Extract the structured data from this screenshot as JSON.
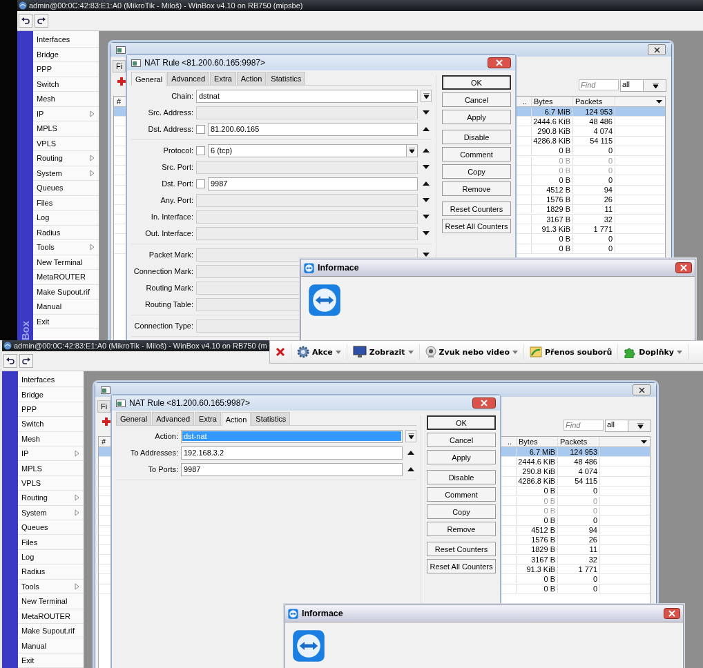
{
  "panels": [
    {
      "title": "admin@00:0C:42:83:E1:A0 (MikroTik - Miloš) - WinBox v4.10 on RB750 (mipsbe)",
      "sidebar": {
        "brand": "Box",
        "items": [
          {
            "label": "Interfaces",
            "submenu": false
          },
          {
            "label": "Bridge",
            "submenu": false
          },
          {
            "label": "PPP",
            "submenu": false
          },
          {
            "label": "Switch",
            "submenu": false
          },
          {
            "label": "Mesh",
            "submenu": false
          },
          {
            "label": "IP",
            "submenu": true
          },
          {
            "label": "MPLS",
            "submenu": false
          },
          {
            "label": "VPLS",
            "submenu": false
          },
          {
            "label": "Routing",
            "submenu": true
          },
          {
            "label": "System",
            "submenu": true
          },
          {
            "label": "Queues",
            "submenu": false
          },
          {
            "label": "Files",
            "submenu": false
          },
          {
            "label": "Log",
            "submenu": false
          },
          {
            "label": "Radius",
            "submenu": false
          },
          {
            "label": "Tools",
            "submenu": true
          },
          {
            "label": "New Terminal",
            "submenu": false
          },
          {
            "label": "MetaROUTER",
            "submenu": false
          },
          {
            "label": "Make Supout.rif",
            "submenu": false
          },
          {
            "label": "Manual",
            "submenu": false
          },
          {
            "label": "Exit",
            "submenu": false
          }
        ]
      },
      "firewall": {
        "tab_fragment": "Fi",
        "find_placeholder": "Find",
        "filter": "all",
        "columns": [
          "#",
          "..",
          "Bytes",
          "Packets"
        ],
        "rows": [
          {
            "bytes": "6.7 MiB",
            "packets": "124 953",
            "selected": true,
            "disabled": false
          },
          {
            "bytes": "2444.6 KiB",
            "packets": "48 486",
            "selected": false,
            "disabled": false
          },
          {
            "bytes": "290.8 KiB",
            "packets": "4 074",
            "selected": false,
            "disabled": false
          },
          {
            "bytes": "4286.8 KiB",
            "packets": "54 115",
            "selected": false,
            "disabled": false
          },
          {
            "bytes": "0 B",
            "packets": "0",
            "selected": false,
            "disabled": false
          },
          {
            "bytes": "0 B",
            "packets": "0",
            "selected": false,
            "disabled": true
          },
          {
            "bytes": "0 B",
            "packets": "0",
            "selected": false,
            "disabled": true
          },
          {
            "bytes": "0 B",
            "packets": "0",
            "selected": false,
            "disabled": false
          },
          {
            "bytes": "4512 B",
            "packets": "94",
            "selected": false,
            "disabled": false
          },
          {
            "bytes": "1576 B",
            "packets": "26",
            "selected": false,
            "disabled": false
          },
          {
            "bytes": "1829 B",
            "packets": "11",
            "selected": false,
            "disabled": false
          },
          {
            "bytes": "3167 B",
            "packets": "32",
            "selected": false,
            "disabled": false
          },
          {
            "bytes": "91.3 KiB",
            "packets": "1 771",
            "selected": false,
            "disabled": false
          },
          {
            "bytes": "0 B",
            "packets": "0",
            "selected": false,
            "disabled": false
          },
          {
            "bytes": "0 B",
            "packets": "0",
            "selected": false,
            "disabled": false
          }
        ]
      },
      "dialog": {
        "title": "NAT Rule <81.200.60.165:9987>",
        "tabs": [
          {
            "label": "General",
            "selected": true
          },
          {
            "label": "Advanced",
            "selected": false
          },
          {
            "label": "Extra",
            "selected": false
          },
          {
            "label": "Action",
            "selected": false
          },
          {
            "label": "Statistics",
            "selected": false
          }
        ],
        "field_groups": [
          [
            {
              "kind": "select",
              "label": "Chain:",
              "value": "dstnat",
              "disabled": false,
              "highlighted": false
            },
            {
              "kind": "list",
              "label": "Src. Address:",
              "disabled": true,
              "highlighted": false
            },
            {
              "kind": "entry",
              "label": "Dst. Address:",
              "value": "81.200.60.165",
              "checked": false,
              "disabled": false,
              "highlighted": false
            }
          ],
          [
            {
              "kind": "select_entry",
              "label": "Protocol:",
              "value": "6 (tcp)",
              "checked": false,
              "disabled": false,
              "highlighted": false
            },
            {
              "kind": "list",
              "label": "Src. Port:",
              "disabled": true,
              "highlighted": false
            },
            {
              "kind": "entry",
              "label": "Dst. Port:",
              "value": "9987",
              "checked": false,
              "disabled": false,
              "highlighted": false
            },
            {
              "kind": "list",
              "label": "Any. Port:",
              "disabled": true,
              "highlighted": false
            },
            {
              "kind": "list",
              "label": "In. Interface:",
              "disabled": true,
              "highlighted": false
            },
            {
              "kind": "list",
              "label": "Out. Interface:",
              "disabled": true,
              "highlighted": false
            }
          ],
          [
            {
              "kind": "list",
              "label": "Packet Mark:",
              "disabled": true,
              "highlighted": false
            },
            {
              "kind": "list",
              "label": "Connection Mark:",
              "disabled": true,
              "highlighted": false
            },
            {
              "kind": "list",
              "label": "Routing Mark:",
              "disabled": true,
              "highlighted": false
            },
            {
              "kind": "list",
              "label": "Routing Table:",
              "disabled": true,
              "highlighted": false
            }
          ],
          [
            {
              "kind": "list",
              "label": "Connection Type:",
              "disabled": true,
              "highlighted": false
            }
          ]
        ],
        "button_groups": [
          [
            {
              "label": "OK",
              "default": true
            },
            {
              "label": "Cancel",
              "default": false
            },
            {
              "label": "Apply",
              "default": false
            }
          ],
          [
            {
              "label": "Disable",
              "default": false
            },
            {
              "label": "Comment",
              "default": false
            },
            {
              "label": "Copy",
              "default": false
            },
            {
              "label": "Remove",
              "default": false
            }
          ],
          [
            {
              "label": "Reset Counters",
              "default": false
            },
            {
              "label": "Reset All Counters",
              "default": false
            }
          ]
        ]
      },
      "info": {
        "title": "Informace"
      }
    },
    {
      "title": "admin@00:0C:42:83:E1:A0 (MikroTik - Miloš) - WinBox v4.10 on RB750 (m",
      "sidebar": {
        "items": [
          {
            "label": "Interfaces",
            "submenu": false
          },
          {
            "label": "Bridge",
            "submenu": false
          },
          {
            "label": "PPP",
            "submenu": false
          },
          {
            "label": "Switch",
            "submenu": false
          },
          {
            "label": "Mesh",
            "submenu": false
          },
          {
            "label": "IP",
            "submenu": true
          },
          {
            "label": "MPLS",
            "submenu": false
          },
          {
            "label": "VPLS",
            "submenu": false
          },
          {
            "label": "Routing",
            "submenu": true
          },
          {
            "label": "System",
            "submenu": true
          },
          {
            "label": "Queues",
            "submenu": false
          },
          {
            "label": "Files",
            "submenu": false
          },
          {
            "label": "Log",
            "submenu": false
          },
          {
            "label": "Radius",
            "submenu": false
          },
          {
            "label": "Tools",
            "submenu": true
          },
          {
            "label": "New Terminal",
            "submenu": false
          },
          {
            "label": "MetaROUTER",
            "submenu": false
          },
          {
            "label": "Make Supout.rif",
            "submenu": false
          },
          {
            "label": "Manual",
            "submenu": false
          },
          {
            "label": "Exit",
            "submenu": false
          }
        ]
      },
      "firewall": {
        "tab_fragment": "Fi",
        "find_placeholder": "Find",
        "filter": "all",
        "columns": [
          "#",
          "..",
          "Bytes",
          "Packets"
        ],
        "rows": [
          {
            "bytes": "6.7 MiB",
            "packets": "124 953",
            "selected": true,
            "disabled": false
          },
          {
            "bytes": "2444.6 KiB",
            "packets": "48 486",
            "selected": false,
            "disabled": false
          },
          {
            "bytes": "290.8 KiB",
            "packets": "4 074",
            "selected": false,
            "disabled": false
          },
          {
            "bytes": "4286.8 KiB",
            "packets": "54 115",
            "selected": false,
            "disabled": false
          },
          {
            "bytes": "0 B",
            "packets": "0",
            "selected": false,
            "disabled": false
          },
          {
            "bytes": "0 B",
            "packets": "0",
            "selected": false,
            "disabled": true
          },
          {
            "bytes": "0 B",
            "packets": "0",
            "selected": false,
            "disabled": true
          },
          {
            "bytes": "0 B",
            "packets": "0",
            "selected": false,
            "disabled": false
          },
          {
            "bytes": "4512 B",
            "packets": "94",
            "selected": false,
            "disabled": false
          },
          {
            "bytes": "1576 B",
            "packets": "26",
            "selected": false,
            "disabled": false
          },
          {
            "bytes": "1829 B",
            "packets": "11",
            "selected": false,
            "disabled": false
          },
          {
            "bytes": "3167 B",
            "packets": "32",
            "selected": false,
            "disabled": false
          },
          {
            "bytes": "91.3 KiB",
            "packets": "1 771",
            "selected": false,
            "disabled": false
          },
          {
            "bytes": "0 B",
            "packets": "0",
            "selected": false,
            "disabled": false
          },
          {
            "bytes": "0 B",
            "packets": "0",
            "selected": false,
            "disabled": false
          }
        ]
      },
      "dialog": {
        "title": "NAT Rule <81.200.60.165:9987>",
        "tabs": [
          {
            "label": "General",
            "selected": false
          },
          {
            "label": "Advanced",
            "selected": false
          },
          {
            "label": "Extra",
            "selected": false
          },
          {
            "label": "Action",
            "selected": true
          },
          {
            "label": "Statistics",
            "selected": false
          }
        ],
        "field_groups": [
          [
            {
              "kind": "select",
              "label": "Action:",
              "value": "dst-nat",
              "disabled": false,
              "highlighted": true
            },
            {
              "kind": "entry",
              "label": "To Addresses:",
              "value": "192.168.3.2",
              "disabled": false,
              "highlighted": false
            },
            {
              "kind": "entry",
              "label": "To Ports:",
              "value": "9987",
              "disabled": false,
              "highlighted": false
            }
          ]
        ],
        "button_groups": [
          [
            {
              "label": "OK",
              "default": true
            },
            {
              "label": "Cancel",
              "default": false
            },
            {
              "label": "Apply",
              "default": false
            }
          ],
          [
            {
              "label": "Disable",
              "default": false
            },
            {
              "label": "Comment",
              "default": false
            },
            {
              "label": "Copy",
              "default": false
            },
            {
              "label": "Remove",
              "default": false
            }
          ],
          [
            {
              "label": "Reset Counters",
              "default": false
            },
            {
              "label": "Reset All Counters",
              "default": false
            }
          ]
        ]
      },
      "info": {
        "title": "Informace"
      }
    }
  ],
  "teamviewer_toolbar": {
    "items": [
      {
        "kind": "close"
      },
      {
        "kind": "gear",
        "label": "Akce",
        "menu": true
      },
      {
        "kind": "monitor",
        "label": "Zobrazit",
        "menu": true
      },
      {
        "kind": "webcam",
        "label": "Zvuk nebo video",
        "menu": true
      },
      {
        "kind": "files",
        "label": "Přenos souborů",
        "menu": false
      },
      {
        "kind": "puzzle",
        "label": "Doplňky",
        "menu": true
      }
    ]
  }
}
